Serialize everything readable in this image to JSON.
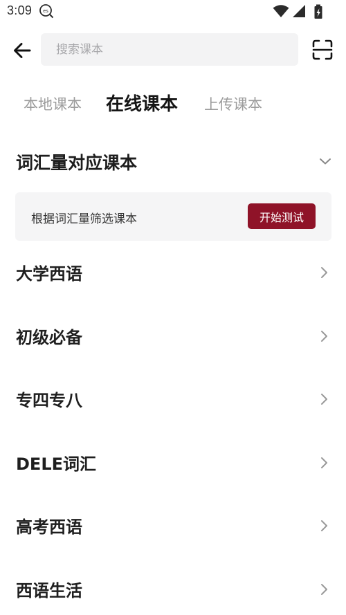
{
  "status_bar": {
    "time": "3:09",
    "app_icon": "es-icon",
    "icons": [
      "wifi-icon",
      "cell-signal-icon",
      "battery-icon"
    ]
  },
  "header": {
    "back_icon": "arrow-left-icon",
    "search_placeholder": "搜索课本",
    "scan_icon": "scan-icon"
  },
  "tabs": [
    {
      "label": "本地课本",
      "active": false
    },
    {
      "label": "在线课本",
      "active": true
    },
    {
      "label": "上传课本",
      "active": false
    }
  ],
  "vocab_section": {
    "title": "词汇量对应课本",
    "expand_icon": "chevron-down-icon",
    "card_text": "根据词汇量筛选课本",
    "button_label": "开始测试"
  },
  "categories": [
    {
      "label": "大学西语"
    },
    {
      "label": "初级必备"
    },
    {
      "label": "专四专八"
    },
    {
      "label": "DELE词汇"
    },
    {
      "label": "高考西语"
    },
    {
      "label": "西语生活"
    }
  ],
  "colors": {
    "accent": "#8f1328",
    "search_bg": "#f3f3f4",
    "card_bg": "#f5f5f6",
    "inactive_tab": "#9c9c9c"
  }
}
